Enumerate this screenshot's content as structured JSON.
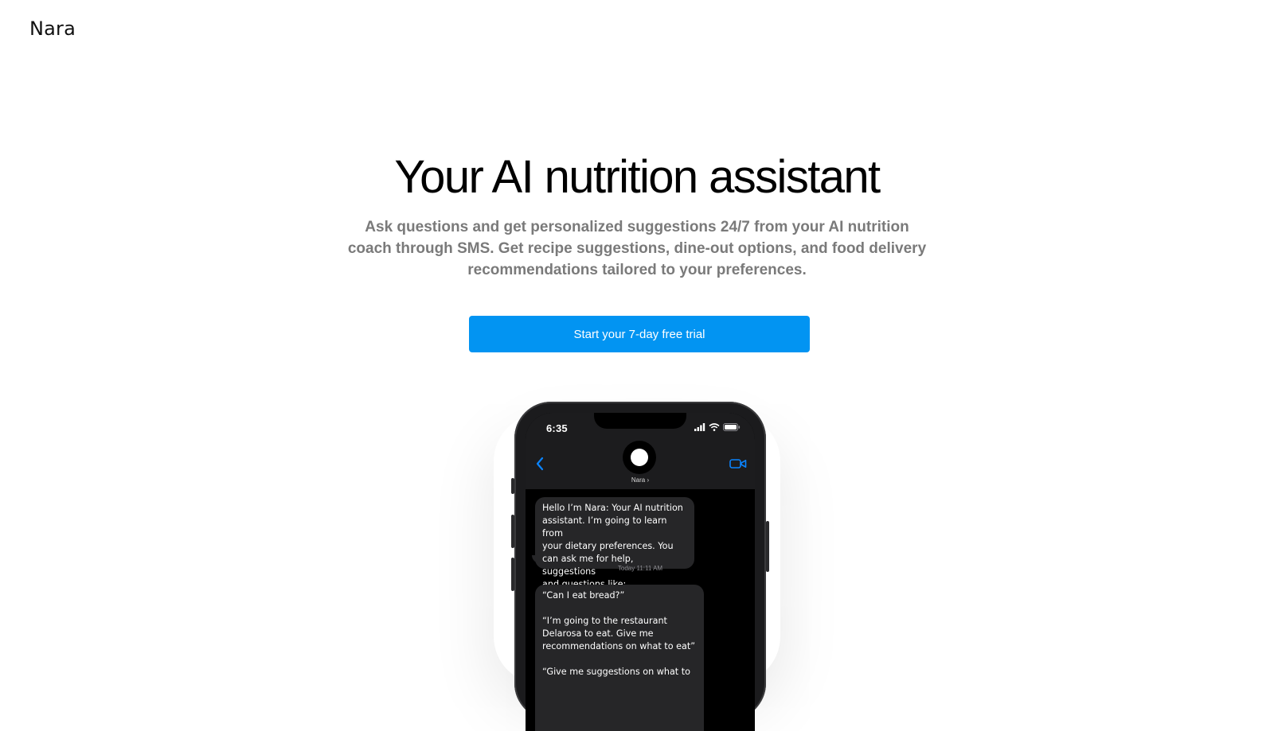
{
  "header": {
    "logo_text": "Nara"
  },
  "hero": {
    "headline": "Your AI nutrition assistant",
    "subtitle_lines": [
      "Ask questions and get personalized suggestions 24/7 from your AI nutrition",
      "coach through SMS. Get recipe suggestions, dine-out options, and food delivery",
      "recommendations tailored to your preferences."
    ],
    "cta_label": "Start your 7-day free trial"
  },
  "phone": {
    "status_time": "6:35",
    "contact_name": "Nara ›",
    "message_1_lines": [
      "Hello I’m Nara: Your AI nutrition",
      "assistant. I’m going to learn from",
      "your dietary preferences. You",
      "can ask me for help, suggestions",
      "and questions like:"
    ],
    "timestamp": "Today 11:11 AM",
    "message_2": {
      "line_1": "“Can I eat bread?”",
      "block_2_lines": [
        "“I’m going to the restaurant",
        "Delarosa to eat. Give me",
        "recommendations on what to eat”"
      ],
      "line_3": "“Give me suggestions on what to"
    },
    "icons": {
      "back": "chevron-left-icon",
      "video": "video-camera-icon",
      "signal": "cellular-signal-icon",
      "wifi": "wifi-icon",
      "battery": "battery-icon"
    },
    "colors": {
      "ios_blue": "#0a84ff",
      "bubble_gray": "#262628",
      "screen_bg": "#000000"
    }
  },
  "colors": {
    "cta_bg": "#0294f2",
    "subtitle": "#7a7a7a",
    "headline": "#000000"
  }
}
